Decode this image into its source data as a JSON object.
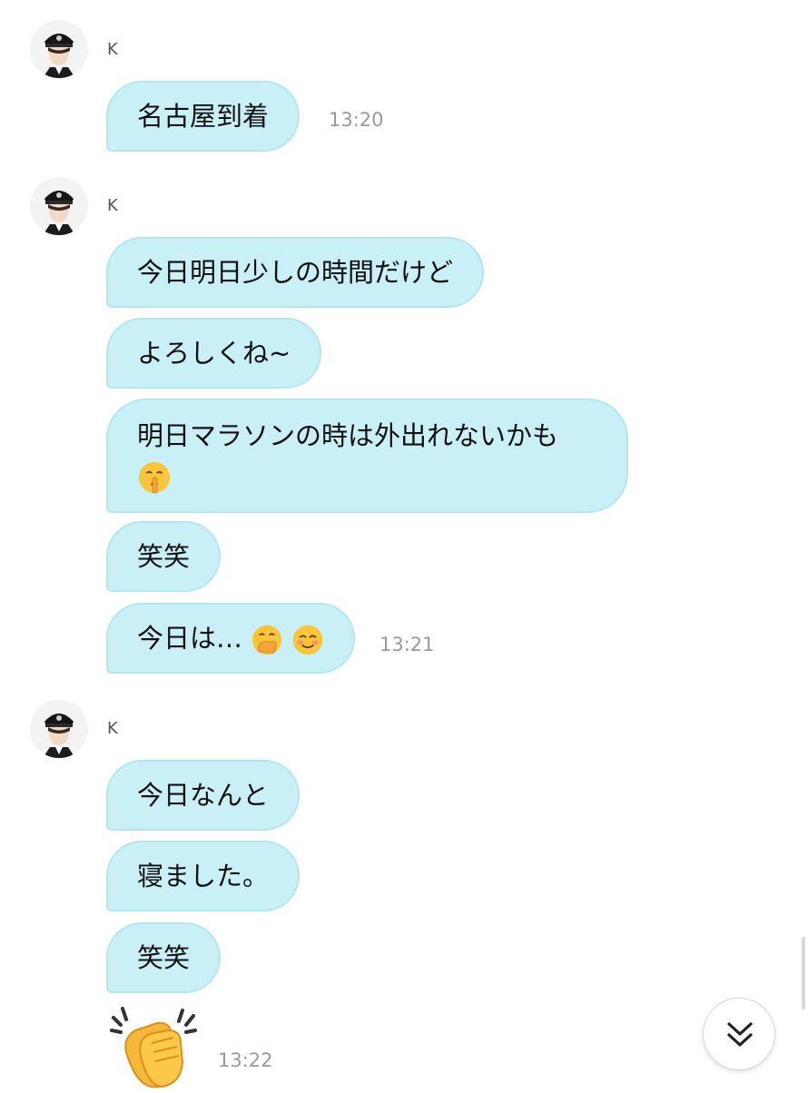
{
  "messages": [
    {
      "sender": "K",
      "bubbles": [
        {
          "text": "名古屋到着"
        }
      ],
      "time": "13:20"
    },
    {
      "sender": "K",
      "bubbles": [
        {
          "text": "今日明日少しの時間だけど"
        },
        {
          "text": "よろしくね~"
        },
        {
          "text": "明日マラソンの時は外出れないかも",
          "emoji": "shushing-face-emoji"
        },
        {
          "text": "笑笑"
        },
        {
          "text": "今日は…",
          "emoji": [
            "hand-over-mouth-emoji",
            "smiling-face-emoji"
          ]
        }
      ],
      "time": "13:21"
    },
    {
      "sender": "K",
      "bubbles": [
        {
          "text": "今日なんと"
        },
        {
          "text": "寝ました。"
        },
        {
          "text": "笑笑"
        },
        {
          "sticker": "clapping-hands-emoji"
        }
      ],
      "time": "13:22"
    }
  ],
  "colors": {
    "bubble": "#c8f0f6",
    "bubble_border": "#b4e6ee",
    "time": "#9a9a9a"
  },
  "scroll_button_icon": "double-chevron-down-icon"
}
